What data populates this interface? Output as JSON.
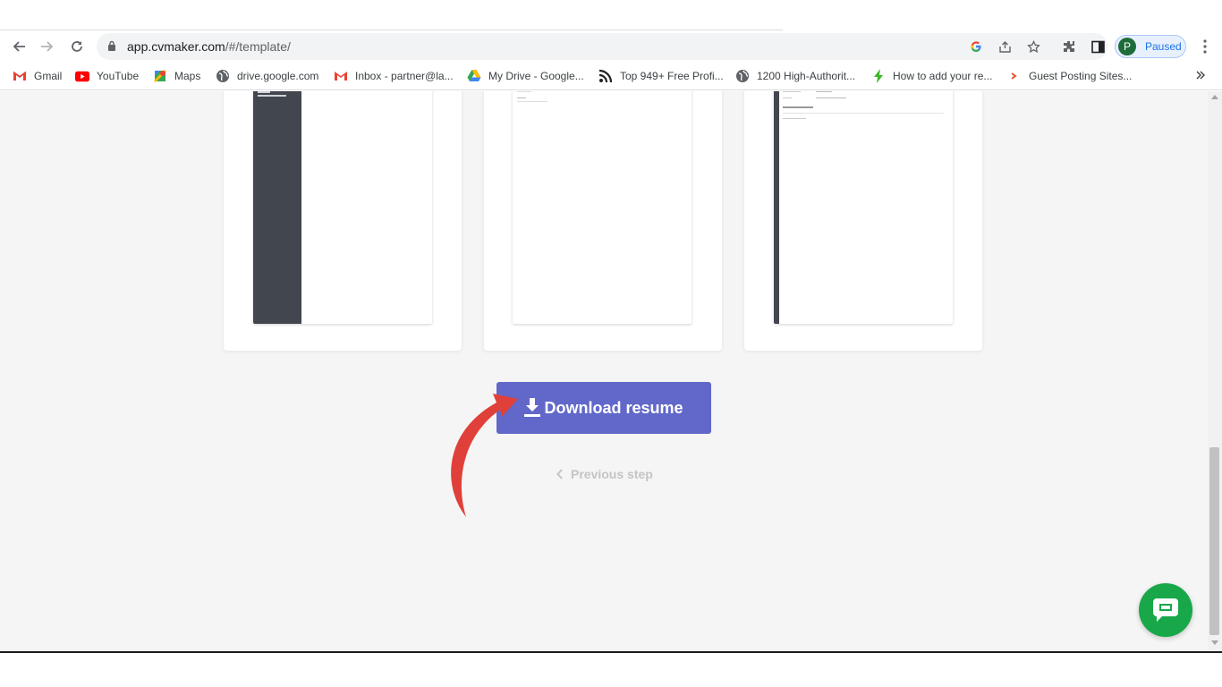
{
  "browser": {
    "url_host": "app.cvmaker.com",
    "url_path": "/#/template/",
    "profile_initial": "P",
    "profile_status": "Paused"
  },
  "bookmarks": [
    {
      "label": "Gmail",
      "icon": "gmail-icon"
    },
    {
      "label": "YouTube",
      "icon": "youtube-icon"
    },
    {
      "label": "Maps",
      "icon": "maps-icon"
    },
    {
      "label": "drive.google.com",
      "icon": "globe-icon"
    },
    {
      "label": "Inbox - partner@la...",
      "icon": "gmail-icon"
    },
    {
      "label": "My Drive - Google...",
      "icon": "drive-icon"
    },
    {
      "label": "Top 949+ Free Profi...",
      "icon": "feed-icon"
    },
    {
      "label": "1200 High-Authorit...",
      "icon": "globe-icon"
    },
    {
      "label": "How to add your re...",
      "icon": "bolt-icon"
    },
    {
      "label": "Guest Posting Sites...",
      "icon": "arrow-site-icon"
    }
  ],
  "main": {
    "download_label": "Download resume",
    "previous_label": "Previous step"
  },
  "colors": {
    "accent": "#6168c9",
    "chat": "#18a84a",
    "arrow": "#e0403a",
    "sidebar_dark": "#42464f"
  }
}
